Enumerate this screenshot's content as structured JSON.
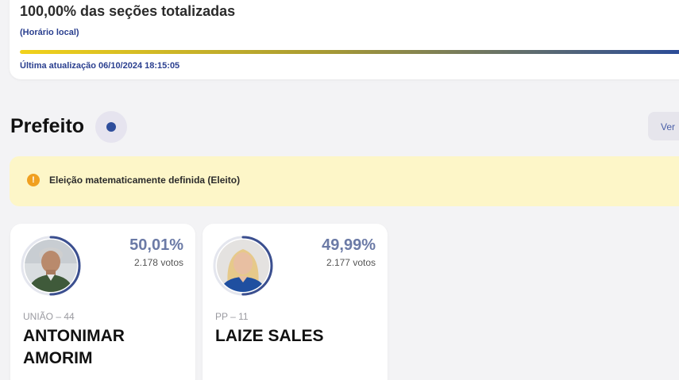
{
  "status": {
    "title": "100,00% das seções totalizadas",
    "local_time_label": "(Horário local)",
    "progress_percent": 100,
    "last_update": "Última atualização 06/10/2024 18:15:05"
  },
  "section": {
    "title": "Prefeito",
    "info_icon": "info-icon",
    "ver_button_label": "Ver"
  },
  "alert": {
    "icon": "warning-icon",
    "text": "Eleição matematicamente definida (Eleito)"
  },
  "candidates": [
    {
      "percent": "50,01%",
      "percent_value": 50.01,
      "votes": "2.178 votos",
      "party": "UNIÃO – 44",
      "name": "ANTONIMAR AMORIM",
      "ring_color": "#3b4f8f"
    },
    {
      "percent": "49,99%",
      "percent_value": 49.99,
      "votes": "2.177 votos",
      "party": "PP – 11",
      "name": "LAIZE SALES",
      "ring_color": "#3b4f8f"
    }
  ],
  "colors": {
    "accent_blue": "#2a3f8f",
    "alert_bg": "#fdf6c8",
    "warning": "#f0a020",
    "percent_text": "#6b7aa6"
  }
}
